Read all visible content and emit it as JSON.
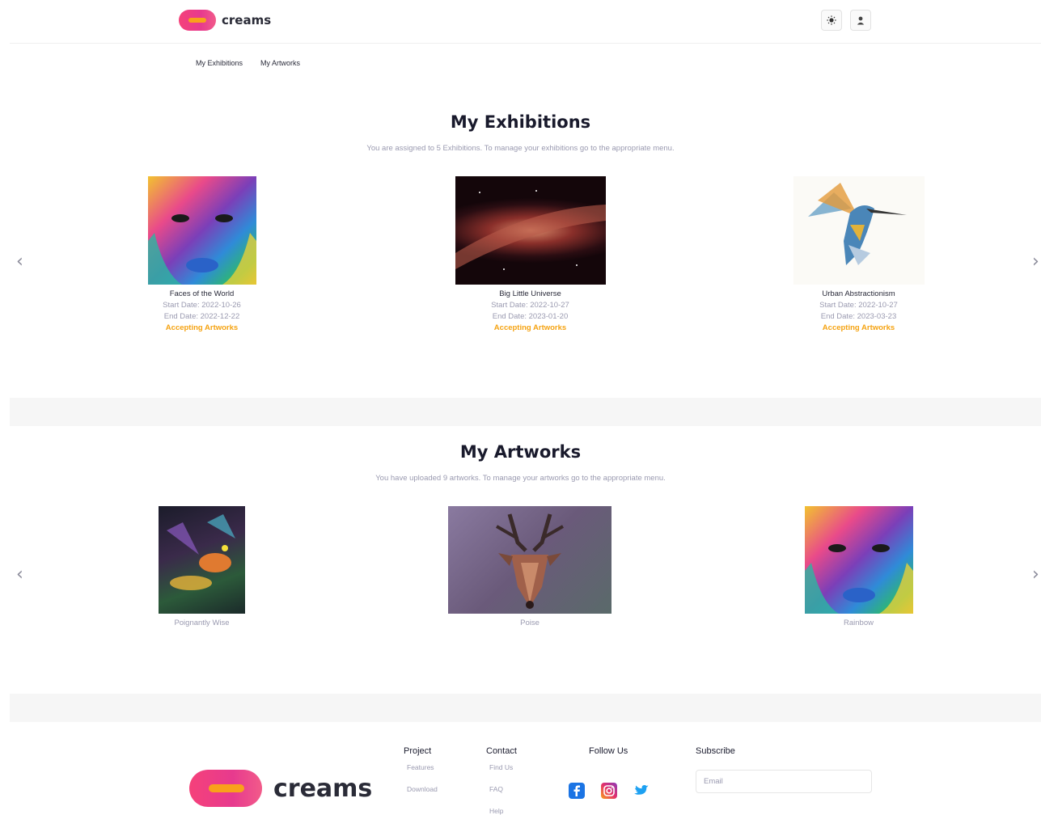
{
  "header": {
    "logo_text": "creams",
    "theme_icon": "sun-icon",
    "user_icon": "user-icon"
  },
  "subnav": {
    "exhibitions": "My Exhibitions",
    "artworks": "My Artworks"
  },
  "exhibitions": {
    "title": "My Exhibitions",
    "subtitle": "You are assigned to 5 Exhibitions. To manage your exhibitions go to the appropriate menu.",
    "items": [
      {
        "name": "Faces of the World",
        "start": "Start Date: 2022-10-26",
        "end": "End Date: 2022-12-22",
        "status": "Accepting Artworks"
      },
      {
        "name": "Big Little Universe",
        "start": "Start Date: 2022-10-27",
        "end": "End Date: 2023-01-20",
        "status": "Accepting Artworks"
      },
      {
        "name": "Urban Abstractionism",
        "start": "Start Date: 2022-10-27",
        "end": "End Date: 2023-03-23",
        "status": "Accepting Artworks"
      }
    ]
  },
  "artworks": {
    "title": "My Artworks",
    "subtitle": "You have uploaded 9 artworks. To manage your artworks go to the appropriate menu.",
    "items": [
      {
        "name": "Poignantly Wise"
      },
      {
        "name": "Poise"
      },
      {
        "name": "Rainbow"
      }
    ]
  },
  "footer": {
    "logo_text": "creams",
    "project": {
      "title": "Project",
      "links": [
        "Features",
        "Download"
      ]
    },
    "contact": {
      "title": "Contact",
      "links": [
        "Find Us",
        "FAQ",
        "Help"
      ]
    },
    "follow": {
      "title": "Follow Us"
    },
    "subscribe": {
      "title": "Subscribe",
      "placeholder": "Email"
    }
  },
  "colors": {
    "accent": "#f5a312",
    "brand_pink": "#e73a8e",
    "brand_orange": "#f9a11b"
  }
}
